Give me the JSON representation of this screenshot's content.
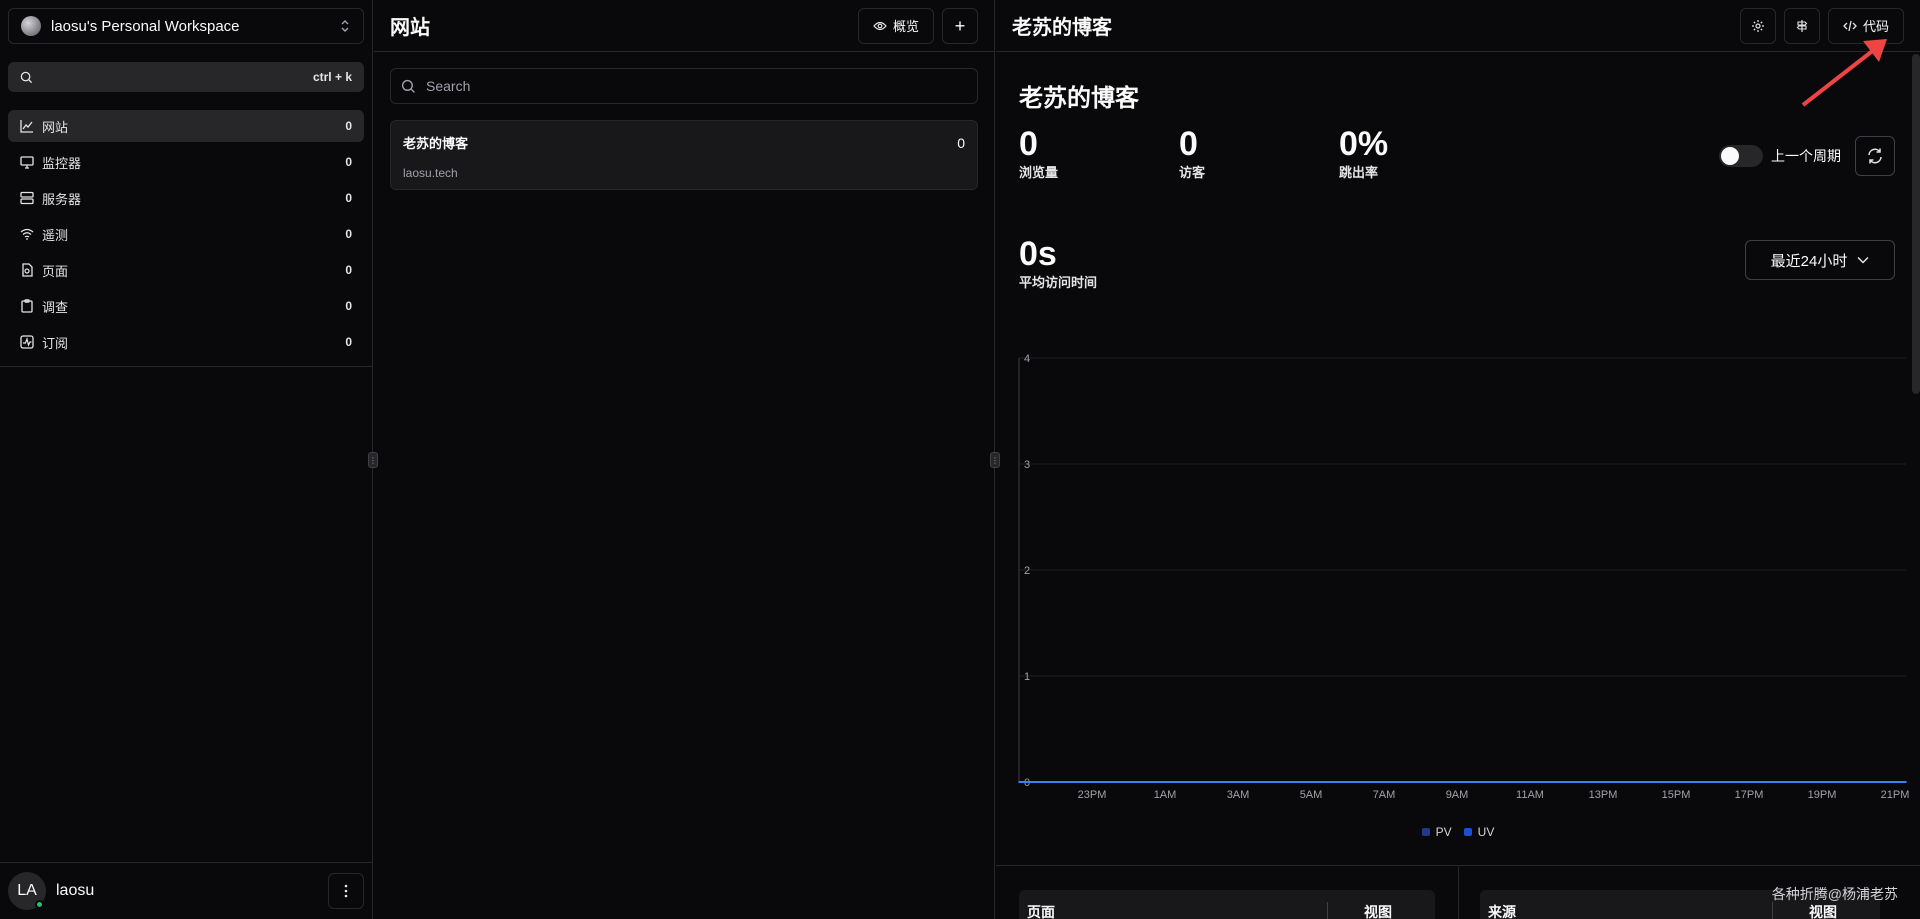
{
  "workspace": {
    "name": "laosu's Personal Workspace"
  },
  "global_search": {
    "shortcut": "ctrl + k"
  },
  "sidebar": {
    "items": [
      {
        "label": "网站",
        "count": "0",
        "icon": "chart-icon",
        "active": true
      },
      {
        "label": "监控器",
        "count": "0",
        "icon": "monitor-icon"
      },
      {
        "label": "服务器",
        "count": "0",
        "icon": "server-icon"
      },
      {
        "label": "遥测",
        "count": "0",
        "icon": "wifi-icon"
      },
      {
        "label": "页面",
        "count": "0",
        "icon": "file-icon"
      },
      {
        "label": "调查",
        "count": "0",
        "icon": "clipboard-icon"
      },
      {
        "label": "订阅",
        "count": "0",
        "icon": "activity-icon"
      }
    ]
  },
  "user": {
    "initials": "LA",
    "name": "laosu"
  },
  "middle": {
    "title": "网站",
    "overview_label": "概览",
    "add_label": "+",
    "search_placeholder": "Search",
    "sites": [
      {
        "name": "老苏的博客",
        "url": "laosu.tech",
        "count": "0"
      }
    ]
  },
  "right": {
    "header_title": "老苏的博客",
    "code_label": "代码",
    "subtitle": "老苏的博客",
    "stats": [
      {
        "value": "0",
        "label": "浏览量"
      },
      {
        "value": "0",
        "label": "访客"
      },
      {
        "value": "0%",
        "label": "跳出率"
      },
      {
        "value": "0s",
        "label": "平均访问时间"
      }
    ],
    "toggle_label": "上一个周期",
    "range_label": "最近24小时",
    "table_left": {
      "col1": "页面",
      "col2": "视图"
    },
    "table_right": {
      "col1": "来源",
      "col2": "视图"
    }
  },
  "chart_data": {
    "type": "line",
    "x": [
      "23PM",
      "1AM",
      "3AM",
      "5AM",
      "7AM",
      "9AM",
      "11AM",
      "13PM",
      "15PM",
      "17PM",
      "19PM",
      "21PM"
    ],
    "series": [
      {
        "name": "PV",
        "values": [
          0,
          0,
          0,
          0,
          0,
          0,
          0,
          0,
          0,
          0,
          0,
          0
        ],
        "color": "#1e3a8a"
      },
      {
        "name": "UV",
        "values": [
          0,
          0,
          0,
          0,
          0,
          0,
          0,
          0,
          0,
          0,
          0,
          0
        ],
        "color": "#1d4ed8"
      }
    ],
    "ylim": [
      0,
      4
    ],
    "yticks": [
      "0",
      "1",
      "2",
      "3",
      "4"
    ],
    "grid": true,
    "legend": "bottom"
  },
  "colors": {
    "accent": "#3b82f6",
    "online": "#22c55e",
    "annotation_arrow": "#ef4444"
  },
  "watermark": "各种折腾@杨浦老苏"
}
